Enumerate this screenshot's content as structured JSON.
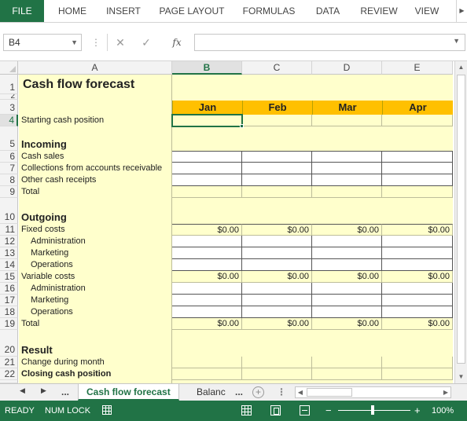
{
  "ribbon": {
    "tabs": [
      "FILE",
      "HOME",
      "INSERT",
      "PAGE LAYOUT",
      "FORMULAS",
      "DATA",
      "REVIEW",
      "VIEW"
    ]
  },
  "formula_bar": {
    "name_box": "B4",
    "fx_label": "fx",
    "formula": ""
  },
  "columns": [
    "A",
    "B",
    "C",
    "D",
    "E"
  ],
  "rows": [
    "1",
    "2",
    "3",
    "4",
    "5",
    "6",
    "7",
    "8",
    "9",
    "10",
    "11",
    "12",
    "13",
    "14",
    "15",
    "16",
    "17",
    "18",
    "19",
    "20",
    "21",
    "22"
  ],
  "sheet": {
    "title": "Cash flow forecast",
    "months": [
      "Jan",
      "Feb",
      "Mar",
      "Apr"
    ],
    "starting_cash_label": "Starting cash position",
    "incoming": {
      "heading": "Incoming",
      "items": [
        "Cash sales",
        "Collections from accounts receivable",
        "Other cash receipts"
      ],
      "total_label": "Total"
    },
    "outgoing": {
      "heading": "Outgoing",
      "fixed_label": "Fixed costs",
      "fixed_values": [
        "$0.00",
        "$0.00",
        "$0.00",
        "$0.00"
      ],
      "fixed_items": [
        "Administration",
        "Marketing",
        "Operations"
      ],
      "variable_label": "Variable costs",
      "variable_values": [
        "$0.00",
        "$0.00",
        "$0.00",
        "$0.00"
      ],
      "variable_items": [
        "Administration",
        "Marketing",
        "Operations"
      ],
      "total_label": "Total",
      "total_values": [
        "$0.00",
        "$0.00",
        "$0.00",
        "$0.00"
      ]
    },
    "result": {
      "heading": "Result",
      "change_label": "Change during month",
      "closing_label": "Closing cash position"
    }
  },
  "sheet_tabs": {
    "ellipsis_left": "...",
    "active": "Cash flow forecast",
    "next": "Balanc",
    "ellipsis_right": "...",
    "add": "+"
  },
  "status": {
    "ready": "READY",
    "num_lock": "NUM LOCK",
    "zoom_minus": "−",
    "zoom_plus": "+",
    "zoom": "100%"
  },
  "colors": {
    "excel_green": "#217346",
    "header_orange": "#ffc000",
    "pale_yellow": "#ffffcc"
  }
}
